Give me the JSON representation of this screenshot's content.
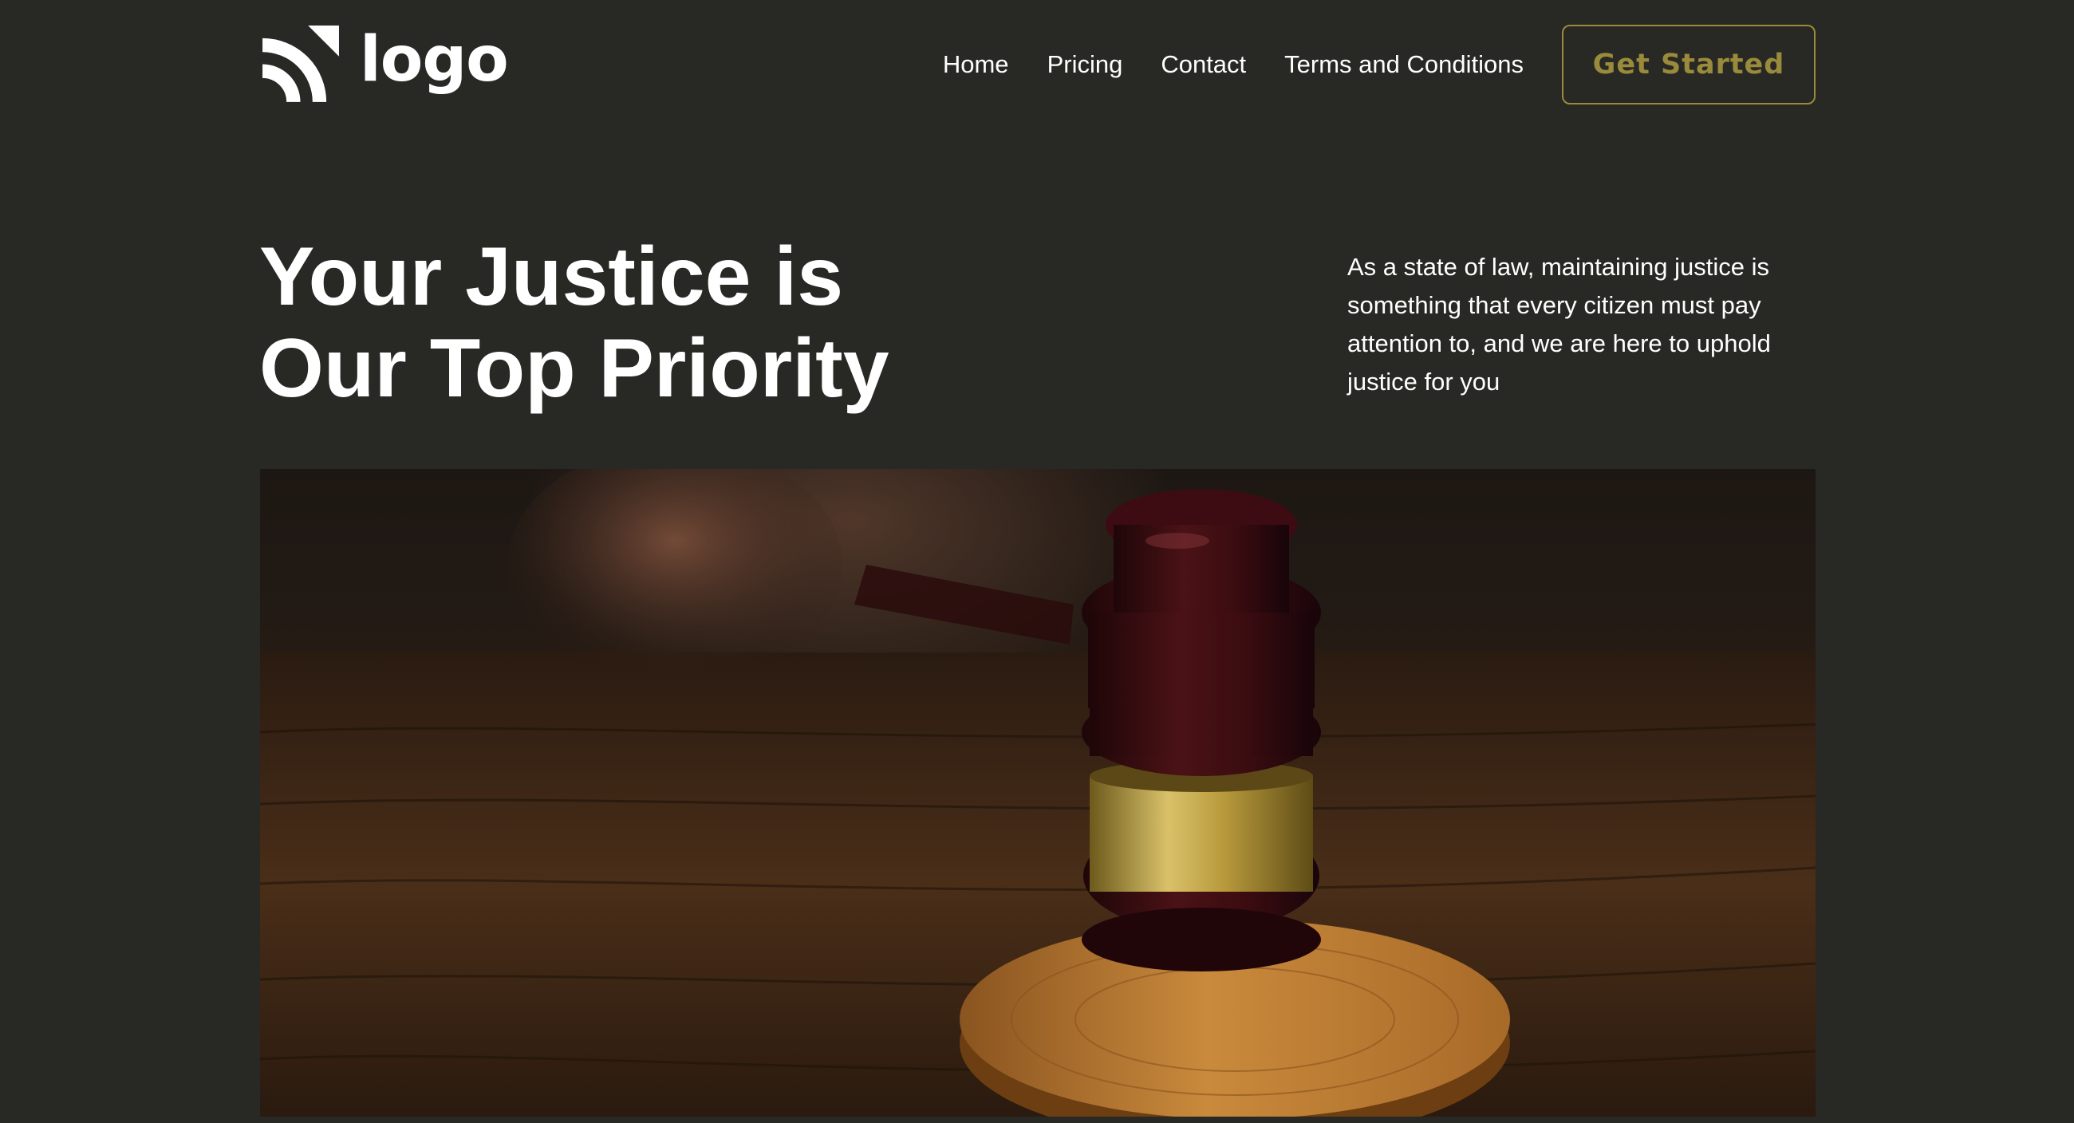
{
  "brand": {
    "logo_text": "logo",
    "logo_icon": "signal-arcs-icon"
  },
  "nav": {
    "items": [
      {
        "label": "Home"
      },
      {
        "label": "Pricing"
      },
      {
        "label": "Contact"
      },
      {
        "label": "Terms and Conditions"
      }
    ],
    "cta_label": "Get Started"
  },
  "hero": {
    "title_line1": "Your Justice is",
    "title_line2": "Our Top Priority",
    "description": "As a state of law, maintaining justice is something that every citizen must pay attention to, and we are here to uphold justice for you",
    "image_subject": "gavel-photo"
  },
  "colors": {
    "background": "#282824",
    "text": "#ffffff",
    "accent": "#9a8a3c"
  }
}
